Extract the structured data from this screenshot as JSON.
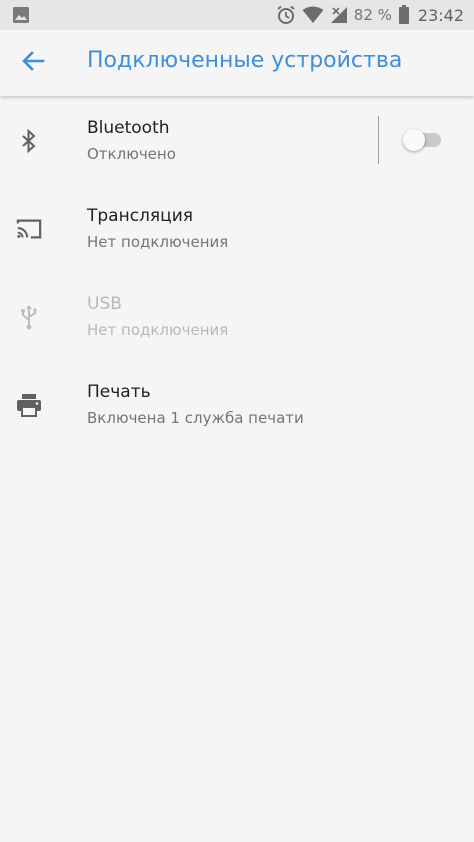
{
  "status_bar": {
    "battery_percent": "82 %",
    "time": "23:42",
    "icons": [
      "image-icon",
      "alarm-icon",
      "wifi-icon",
      "signal-icon",
      "battery-icon"
    ]
  },
  "app_bar": {
    "back_icon": "arrow-back-icon",
    "title": "Подключенные устройства",
    "accent_color": "#3f8fd9"
  },
  "items": [
    {
      "icon": "bluetooth-icon",
      "title": "Bluetooth",
      "subtitle": "Отключено",
      "toggle_on": false,
      "enabled": true
    },
    {
      "icon": "cast-icon",
      "title": "Трансляция",
      "subtitle": "Нет подключения",
      "enabled": true
    },
    {
      "icon": "usb-icon",
      "title": "USB",
      "subtitle": "Нет подключения",
      "enabled": false
    },
    {
      "icon": "print-icon",
      "title": "Печать",
      "subtitle": "Включена 1 служба печати",
      "enabled": true
    }
  ]
}
